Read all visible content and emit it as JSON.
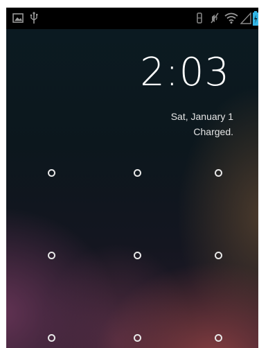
{
  "status_bar": {
    "icons_left": [
      "image-icon",
      "usb-icon"
    ],
    "icons_right": [
      "vibrate-icon",
      "mute-icon",
      "wifi-icon",
      "signal-icon",
      "battery-icon"
    ]
  },
  "lock_screen": {
    "time": "2:03",
    "date": "Sat, January 1",
    "charge_status": "Charged."
  },
  "pattern": {
    "rows": 3,
    "cols": 3,
    "dot_color": "#e8e8e8"
  },
  "colors": {
    "status_bar": "#000000",
    "battery_accent": "#33b5e5",
    "text": "#ffffff"
  }
}
